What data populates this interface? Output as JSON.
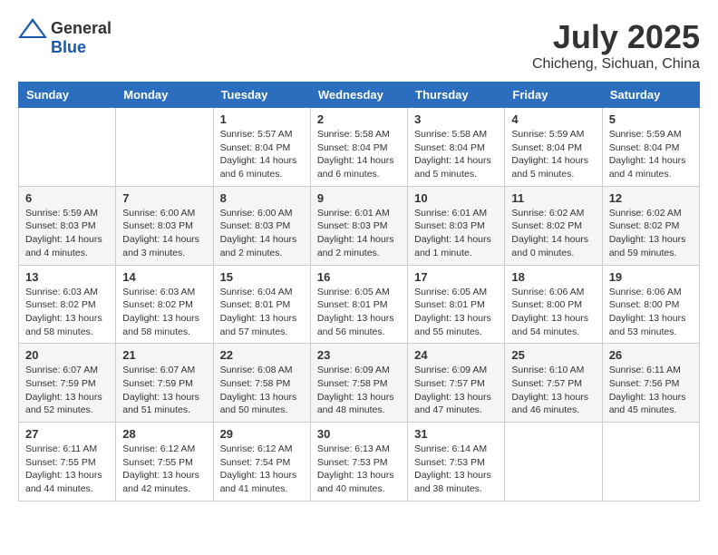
{
  "header": {
    "logo_general": "General",
    "logo_blue": "Blue",
    "month_year": "July 2025",
    "location": "Chicheng, Sichuan, China"
  },
  "weekdays": [
    "Sunday",
    "Monday",
    "Tuesday",
    "Wednesday",
    "Thursday",
    "Friday",
    "Saturday"
  ],
  "weeks": [
    [
      {
        "day": "",
        "info": ""
      },
      {
        "day": "",
        "info": ""
      },
      {
        "day": "1",
        "info": "Sunrise: 5:57 AM\nSunset: 8:04 PM\nDaylight: 14 hours and 6 minutes."
      },
      {
        "day": "2",
        "info": "Sunrise: 5:58 AM\nSunset: 8:04 PM\nDaylight: 14 hours and 6 minutes."
      },
      {
        "day": "3",
        "info": "Sunrise: 5:58 AM\nSunset: 8:04 PM\nDaylight: 14 hours and 5 minutes."
      },
      {
        "day": "4",
        "info": "Sunrise: 5:59 AM\nSunset: 8:04 PM\nDaylight: 14 hours and 5 minutes."
      },
      {
        "day": "5",
        "info": "Sunrise: 5:59 AM\nSunset: 8:04 PM\nDaylight: 14 hours and 4 minutes."
      }
    ],
    [
      {
        "day": "6",
        "info": "Sunrise: 5:59 AM\nSunset: 8:03 PM\nDaylight: 14 hours and 4 minutes."
      },
      {
        "day": "7",
        "info": "Sunrise: 6:00 AM\nSunset: 8:03 PM\nDaylight: 14 hours and 3 minutes."
      },
      {
        "day": "8",
        "info": "Sunrise: 6:00 AM\nSunset: 8:03 PM\nDaylight: 14 hours and 2 minutes."
      },
      {
        "day": "9",
        "info": "Sunrise: 6:01 AM\nSunset: 8:03 PM\nDaylight: 14 hours and 2 minutes."
      },
      {
        "day": "10",
        "info": "Sunrise: 6:01 AM\nSunset: 8:03 PM\nDaylight: 14 hours and 1 minute."
      },
      {
        "day": "11",
        "info": "Sunrise: 6:02 AM\nSunset: 8:02 PM\nDaylight: 14 hours and 0 minutes."
      },
      {
        "day": "12",
        "info": "Sunrise: 6:02 AM\nSunset: 8:02 PM\nDaylight: 13 hours and 59 minutes."
      }
    ],
    [
      {
        "day": "13",
        "info": "Sunrise: 6:03 AM\nSunset: 8:02 PM\nDaylight: 13 hours and 58 minutes."
      },
      {
        "day": "14",
        "info": "Sunrise: 6:03 AM\nSunset: 8:02 PM\nDaylight: 13 hours and 58 minutes."
      },
      {
        "day": "15",
        "info": "Sunrise: 6:04 AM\nSunset: 8:01 PM\nDaylight: 13 hours and 57 minutes."
      },
      {
        "day": "16",
        "info": "Sunrise: 6:05 AM\nSunset: 8:01 PM\nDaylight: 13 hours and 56 minutes."
      },
      {
        "day": "17",
        "info": "Sunrise: 6:05 AM\nSunset: 8:01 PM\nDaylight: 13 hours and 55 minutes."
      },
      {
        "day": "18",
        "info": "Sunrise: 6:06 AM\nSunset: 8:00 PM\nDaylight: 13 hours and 54 minutes."
      },
      {
        "day": "19",
        "info": "Sunrise: 6:06 AM\nSunset: 8:00 PM\nDaylight: 13 hours and 53 minutes."
      }
    ],
    [
      {
        "day": "20",
        "info": "Sunrise: 6:07 AM\nSunset: 7:59 PM\nDaylight: 13 hours and 52 minutes."
      },
      {
        "day": "21",
        "info": "Sunrise: 6:07 AM\nSunset: 7:59 PM\nDaylight: 13 hours and 51 minutes."
      },
      {
        "day": "22",
        "info": "Sunrise: 6:08 AM\nSunset: 7:58 PM\nDaylight: 13 hours and 50 minutes."
      },
      {
        "day": "23",
        "info": "Sunrise: 6:09 AM\nSunset: 7:58 PM\nDaylight: 13 hours and 48 minutes."
      },
      {
        "day": "24",
        "info": "Sunrise: 6:09 AM\nSunset: 7:57 PM\nDaylight: 13 hours and 47 minutes."
      },
      {
        "day": "25",
        "info": "Sunrise: 6:10 AM\nSunset: 7:57 PM\nDaylight: 13 hours and 46 minutes."
      },
      {
        "day": "26",
        "info": "Sunrise: 6:11 AM\nSunset: 7:56 PM\nDaylight: 13 hours and 45 minutes."
      }
    ],
    [
      {
        "day": "27",
        "info": "Sunrise: 6:11 AM\nSunset: 7:55 PM\nDaylight: 13 hours and 44 minutes."
      },
      {
        "day": "28",
        "info": "Sunrise: 6:12 AM\nSunset: 7:55 PM\nDaylight: 13 hours and 42 minutes."
      },
      {
        "day": "29",
        "info": "Sunrise: 6:12 AM\nSunset: 7:54 PM\nDaylight: 13 hours and 41 minutes."
      },
      {
        "day": "30",
        "info": "Sunrise: 6:13 AM\nSunset: 7:53 PM\nDaylight: 13 hours and 40 minutes."
      },
      {
        "day": "31",
        "info": "Sunrise: 6:14 AM\nSunset: 7:53 PM\nDaylight: 13 hours and 38 minutes."
      },
      {
        "day": "",
        "info": ""
      },
      {
        "day": "",
        "info": ""
      }
    ]
  ]
}
